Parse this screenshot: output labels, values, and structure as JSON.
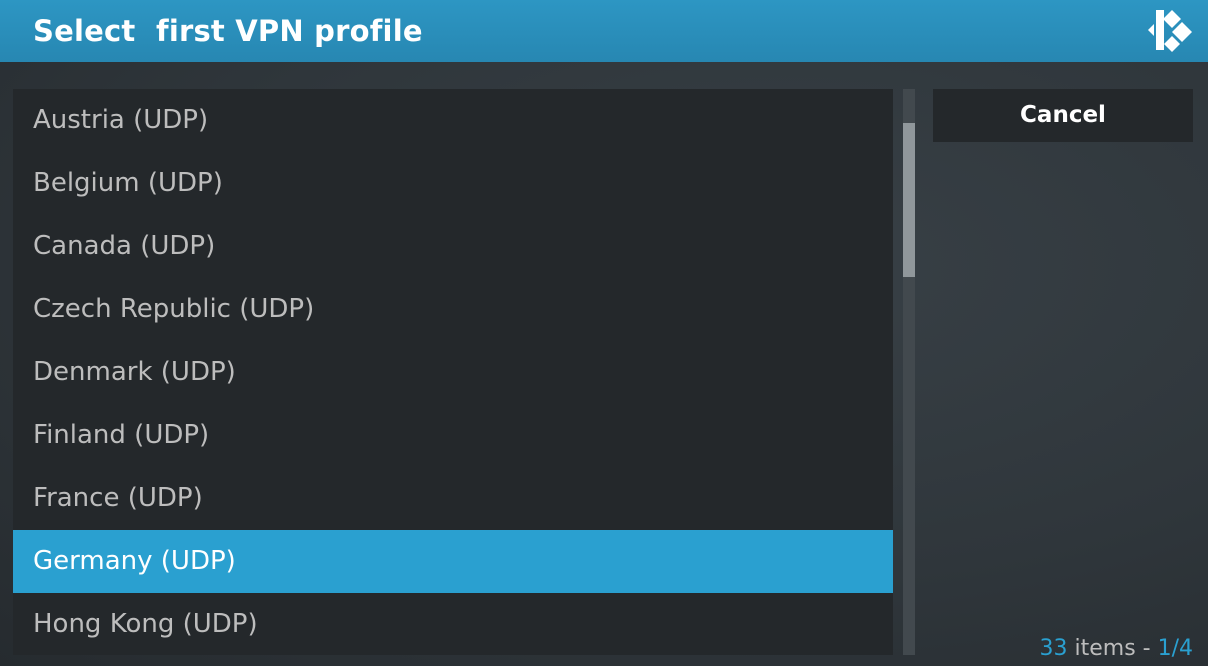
{
  "dialog": {
    "title": "Select  first VPN profile",
    "logo_icon": "kodi-logo-icon"
  },
  "list": {
    "items": [
      {
        "label": "Austria (UDP)",
        "selected": false
      },
      {
        "label": "Belgium (UDP)",
        "selected": false
      },
      {
        "label": "Canada (UDP)",
        "selected": false
      },
      {
        "label": "Czech Republic (UDP)",
        "selected": false
      },
      {
        "label": "Denmark (UDP)",
        "selected": false
      },
      {
        "label": "Finland (UDP)",
        "selected": false
      },
      {
        "label": "France (UDP)",
        "selected": false
      },
      {
        "label": "Germany (UDP)",
        "selected": true
      },
      {
        "label": "Hong Kong (UDP)",
        "selected": false
      }
    ]
  },
  "buttons": {
    "cancel_label": "Cancel"
  },
  "footer": {
    "count": "33",
    "items_text": " items - ",
    "page": "1/4"
  },
  "colors": {
    "header": "#2787b2",
    "accent": "#2aa0d0",
    "panel": "#24282b",
    "text": "#bdbdbd"
  }
}
